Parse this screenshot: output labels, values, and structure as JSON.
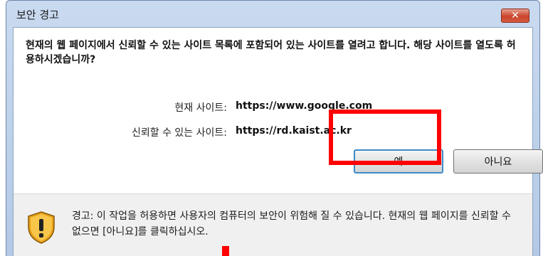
{
  "window": {
    "title": "보안 경고",
    "close_label": "✕"
  },
  "dialog": {
    "message": "현재의 웹 페이지에서 신뢰할 수 있는 사이트 목록에 포함되어 있는 사이트를 열려고 합니다. 해당 사이트를 열도록 허용하시겠습니까?",
    "current_site_label": "현재 사이트:",
    "current_site_value": "https://www.google.com",
    "trusted_site_label": "신뢰할 수 있는 사이트:",
    "trusted_site_value": "https://rd.kaist.ac.kr"
  },
  "buttons": {
    "yes": "예",
    "no": "아니요"
  },
  "footer": {
    "icon": "shield-warning-icon",
    "warning_text": "경고: 이 작업을 허용하면 사용자의 컴퓨터의 보안이 위험해 질 수 있습니다. 현재의 웹 페이지를 신뢰할 수 없으면 [아니요]를 클릭하십시오."
  },
  "colors": {
    "highlight": "#ff0000",
    "frame": "#c9daf0",
    "default_button_border": "#3c8ac9"
  }
}
